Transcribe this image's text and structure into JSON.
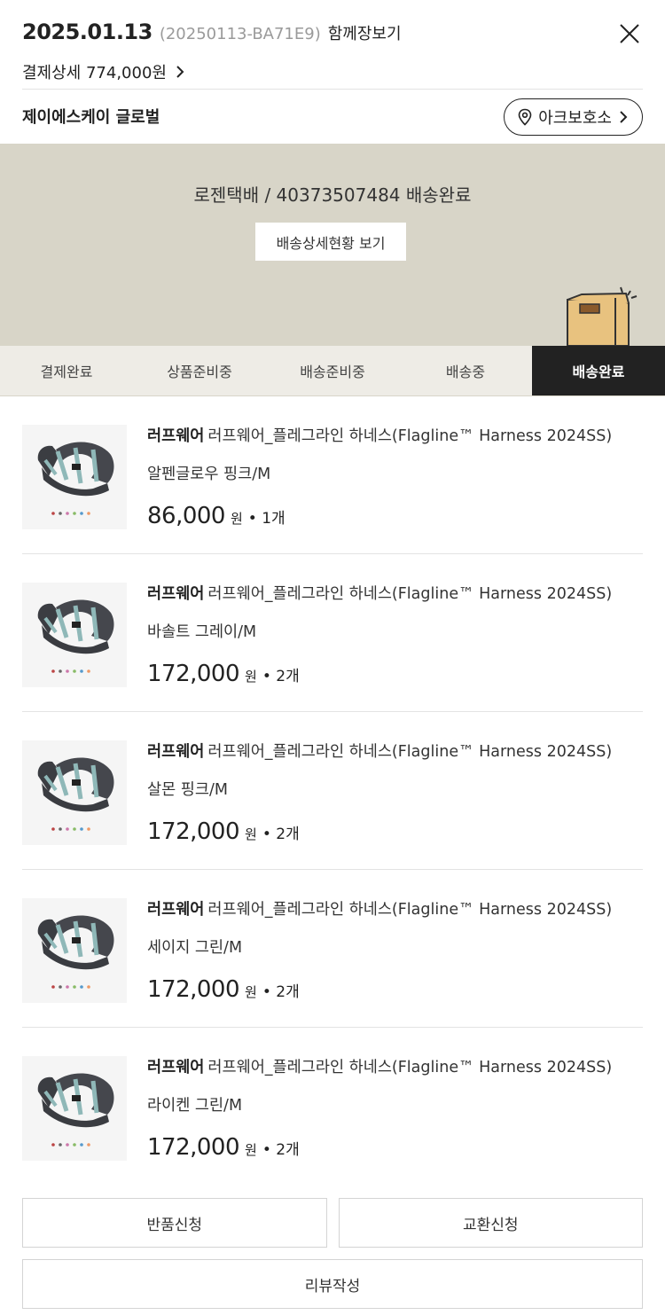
{
  "header": {
    "order_date": "2025.01.13",
    "order_no": "(20250113-BA71E9)",
    "view_together": "함께장보기",
    "payment_detail": "결제상세 774,000원",
    "seller": "제이에스케이 글로벌",
    "store_button": "아크보호소"
  },
  "shipping": {
    "status_text": "로젠택배 / 40373507484 배송완료",
    "detail_button": "배송상세현황 보기"
  },
  "steps": [
    {
      "label": "결제완료"
    },
    {
      "label": "상품준비중"
    },
    {
      "label": "배송준비중"
    },
    {
      "label": "배송중"
    },
    {
      "label": "배송완료"
    }
  ],
  "active_step": "배송완료",
  "items": [
    {
      "brand": "러프웨어",
      "name": "러프웨어_플레그라인 하네스(Flagline™ Harness 2024SS)",
      "option": "알펜글로우 핑크/M",
      "price": "86,000",
      "won": "원",
      "qty": "• 1개",
      "image": "harness-image"
    },
    {
      "brand": "러프웨어",
      "name": "러프웨어_플레그라인 하네스(Flagline™ Harness 2024SS)",
      "option": "바솔트 그레이/M",
      "price": "172,000",
      "won": "원",
      "qty": "• 2개",
      "image": "harness-image"
    },
    {
      "brand": "러프웨어",
      "name": "러프웨어_플레그라인 하네스(Flagline™ Harness 2024SS)",
      "option": "살몬 핑크/M",
      "price": "172,000",
      "won": "원",
      "qty": "• 2개",
      "image": "harness-image"
    },
    {
      "brand": "러프웨어",
      "name": "러프웨어_플레그라인 하네스(Flagline™ Harness 2024SS)",
      "option": "세이지 그린/M",
      "price": "172,000",
      "won": "원",
      "qty": "• 2개",
      "image": "harness-image"
    },
    {
      "brand": "러프웨어",
      "name": "러프웨어_플레그라인 하네스(Flagline™ Harness 2024SS)",
      "option": "라이켄 그린/M",
      "price": "172,000",
      "won": "원",
      "qty": "• 2개",
      "image": "harness-image"
    }
  ],
  "actions": {
    "return": "반품신청",
    "exchange": "교환신청",
    "review": "리뷰작성"
  },
  "colors": {
    "shipping_bg": "#d8d5c8",
    "active_step_bg": "#222222",
    "box": "#e8c27f"
  },
  "icons": [
    "close-icon",
    "chevron-right-icon",
    "location-pin-icon",
    "delivery-box-icon"
  ]
}
